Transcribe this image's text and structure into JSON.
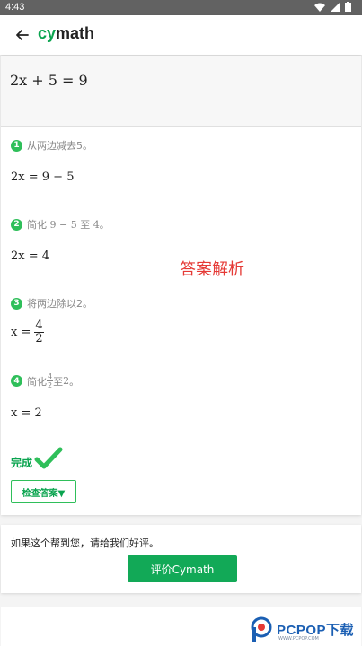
{
  "status_bar": {
    "time": "4:43",
    "icons": [
      "wifi-icon",
      "signal-icon",
      "battery-icon"
    ]
  },
  "app_bar": {
    "brand_c": "cy",
    "brand_m": "math",
    "back_icon": "arrow-left-icon"
  },
  "problem": {
    "equation": "2x + 5 = 9"
  },
  "steps": [
    {
      "num": "1",
      "text": "从两边减去5。",
      "result": "2x = 9 − 5"
    },
    {
      "num": "2",
      "text_pre": "简化 ",
      "text_math": "9 − 5",
      "text_mid": " 至 ",
      "text_math2": "4",
      "text_post": "。",
      "result": "2x = 4"
    },
    {
      "num": "3",
      "text": "将两边除以2。",
      "result_lhs": "x =",
      "result_num": "4",
      "result_den": "2"
    },
    {
      "num": "4",
      "text_pre": "简化 ",
      "frac_num": "4",
      "frac_den": "2",
      "text_mid": " 至 ",
      "text_math2": "2",
      "text_post": "。",
      "result": "x = 2"
    }
  ],
  "overlay_label": "答案解析",
  "done": {
    "label": "完成",
    "check_button": "检查答案▼"
  },
  "rating": {
    "prompt": "如果这个帮到您，请给我们好评。",
    "button": "评价Cymath"
  },
  "watermark": {
    "text": "PCPOP下载",
    "sub": "WWW.PCPOP.COM"
  },
  "colors": {
    "accent": "#0aa44f",
    "button": "#12a957",
    "overlay": "#e53935"
  }
}
